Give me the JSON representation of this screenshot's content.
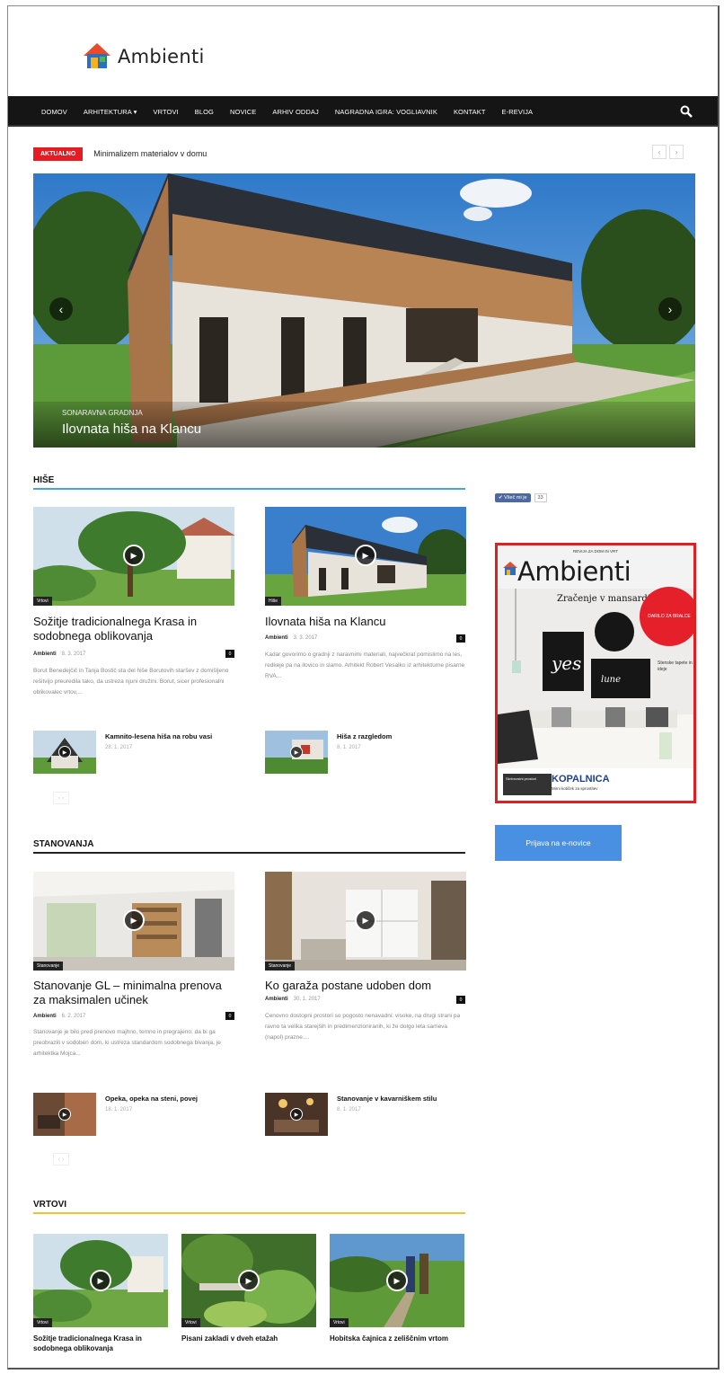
{
  "brand": {
    "name": "Ambienti"
  },
  "nav": {
    "items": [
      "DOMOV",
      "ARHITEKTURA ▾",
      "VRTOVI",
      "BLOG",
      "NOVICE",
      "ARHIV ODDAJ",
      "NAGRADNA IGRA: Vogliavnik",
      "KONTAKT",
      "E-REVIJA"
    ]
  },
  "ticker": {
    "badge": "AKTUALNO",
    "text": "Minimalizem materialov v domu",
    "prev": "‹",
    "next": "›"
  },
  "hero": {
    "category": "SONARAVNA GRADNJA",
    "title": "Ilovnata hiša na Klancu"
  },
  "sections": {
    "hise": {
      "title": "HIŠE",
      "accent": "#4aa3df",
      "main": [
        {
          "tag": "Vrtovi",
          "title": "Sožitje tradicionalnega Krasa in sodobnega oblikovanja",
          "author": "Ambienti",
          "date": "8. 3. 2017",
          "comments": "0",
          "excerpt": "Borut Benedejčič in Tanja Bostič sta del hiše Borutovih staršev z domišljeno rešitvijo preuredila tako, da ustreza njuni družini. Borut, sicer profesionalni oblikovalec vrtov,..."
        },
        {
          "tag": "Hiše",
          "title": "Ilovnata hiša na Klancu",
          "author": "Ambienti",
          "date": "3. 3. 2017",
          "comments": "0",
          "excerpt": "Kadar govorimo o gradnji z naravnimi materiali, največkrat pomislimo na les, redkeje pa na ilovico in slamo. Arhitekt Robert Vesalko iz arhitekturne pisarne RVA..."
        }
      ],
      "small": [
        {
          "title": "Kamnito-lesena hiša na robu vasi",
          "date": "28. 1. 2017"
        },
        {
          "title": "Hiša z razgledom",
          "date": "8. 1. 2017"
        }
      ],
      "pager": "‹ ›"
    },
    "stanovanja": {
      "title": "STANOVANJA",
      "accent": "#222222",
      "main": [
        {
          "tag": "Stanovanje",
          "title": "Stanovanje GL – minimalna prenova za maksimalen učinek",
          "author": "Ambienti",
          "date": "6. 2. 2017",
          "comments": "0",
          "excerpt": "Stanovanje je bilo pred prenovo majhno, temno in pregrajeno: da bi ga preobrazili v sodoben dom, ki ustreza standardom sodobnega bivanja, je arhitektka Mojca..."
        },
        {
          "tag": "Stanovanje",
          "title": "Ko garaža postane udoben dom",
          "author": "Ambienti",
          "date": "30. 1. 2017",
          "comments": "0",
          "excerpt": "Cenovno dostopni prostori so pogosto nenavadni: visoke, na drugi strani pa ravno ta velika starejših in predimenzioniranih, ki že dolgo leta sameva (napol) prazne...."
        }
      ],
      "small": [
        {
          "title": "Opeka, opeka na steni, povej",
          "date": "18. 1. 2017"
        },
        {
          "title": "Stanovanje v kavarniškem stilu",
          "date": "8. 1. 2017"
        }
      ],
      "pager": "‹ ›"
    },
    "vrtovi": {
      "title": "VRTOVI",
      "accent": "#f2c12e",
      "items": [
        {
          "tag": "Vrtovi",
          "title": "Sožitje tradicionalnega Krasa in sodobnega oblikovanja"
        },
        {
          "tag": "Vrtovi",
          "title": "Pisani zakladi v dveh etažah"
        },
        {
          "tag": "Vrtovi",
          "title": "Hobitska čajnica z zeliščnim vrtom"
        }
      ],
      "pager": "‹ ›"
    }
  },
  "sidebar": {
    "like": "✔ Všeč mi je",
    "like_count": "33",
    "magazine": {
      "top": "REVIJA ZA DOM IN VRT",
      "title": "Ambienti",
      "headline": "Zračenje v mansardi",
      "badge": "DARILO ZA BRALCE",
      "note": "Stenske tapete in ideje",
      "box": "Skrivnostni prostori",
      "bottom": "KOPALNICA",
      "bottom_sub": "Mirni kotiček za sprostitev"
    },
    "newsletter": "Prijava na e-novice"
  },
  "colors": {
    "accent_red": "#e51c23",
    "nav_bg": "#151515",
    "newsletter": "#4a90e2"
  }
}
